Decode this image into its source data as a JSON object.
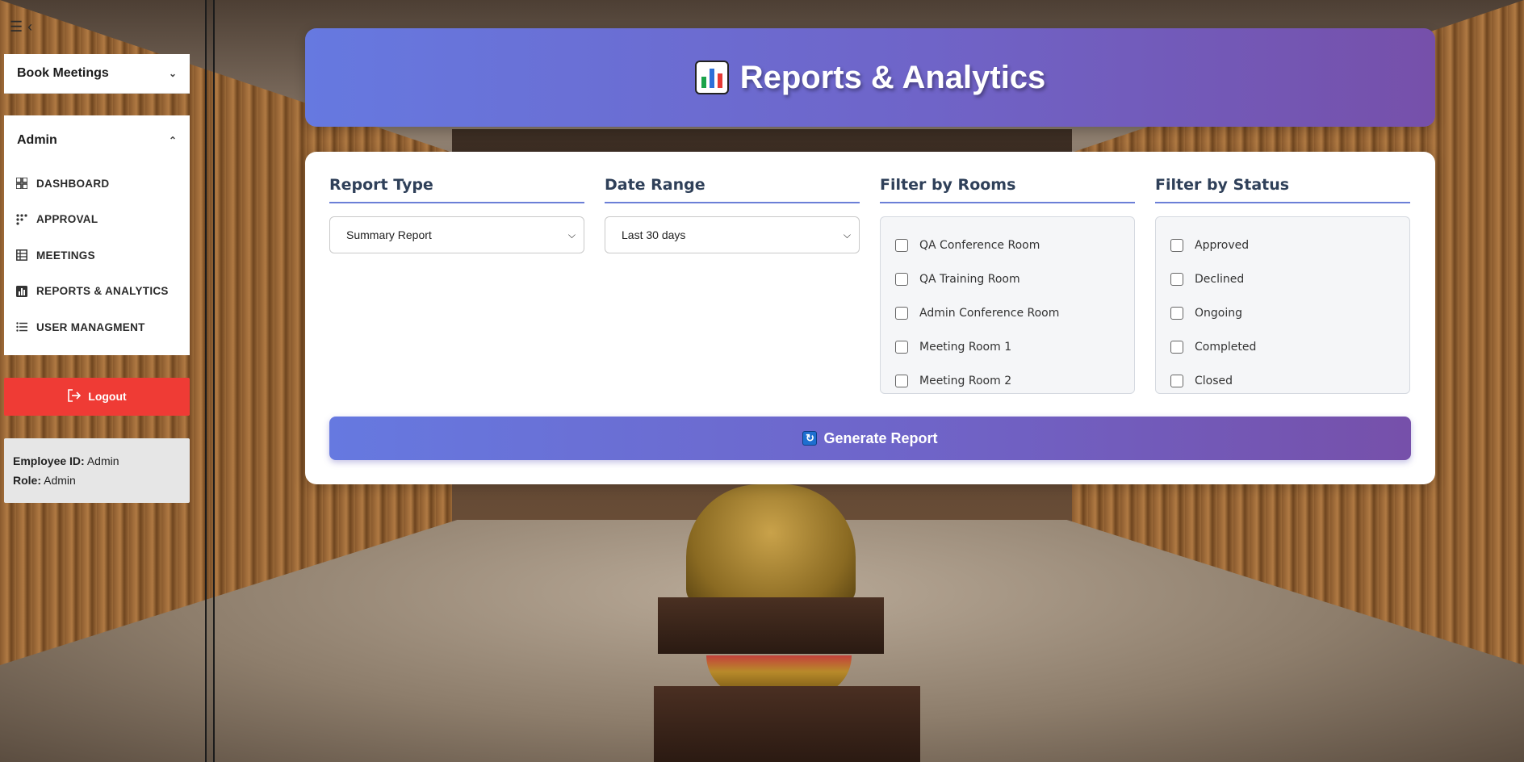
{
  "sidebar": {
    "book_meetings_label": "Book Meetings",
    "admin_label": "Admin",
    "items": [
      {
        "label": "DASHBOARD",
        "icon": "grid-icon"
      },
      {
        "label": "APPROVAL",
        "icon": "dots-icon"
      },
      {
        "label": "MEETINGS",
        "icon": "table-icon"
      },
      {
        "label": "REPORTS & ANALYTICS",
        "icon": "bar-chart-icon"
      },
      {
        "label": "USER MANAGMENT",
        "icon": "list-icon"
      }
    ],
    "logout_label": "Logout",
    "user": {
      "employee_id_label": "Employee ID:",
      "employee_id": "Admin",
      "role_label": "Role:",
      "role": "Admin"
    }
  },
  "header": {
    "title": "Reports & Analytics",
    "icon": "bar-chart-emoji-icon"
  },
  "filters": {
    "report_type": {
      "title": "Report Type",
      "selected": "Summary Report"
    },
    "date_range": {
      "title": "Date Range",
      "selected": "Last 30 days"
    },
    "rooms": {
      "title": "Filter by Rooms",
      "options": [
        "QA Conference Room",
        "QA Training Room",
        "Admin Conference Room",
        "Meeting Room 1",
        "Meeting Room 2"
      ]
    },
    "status": {
      "title": "Filter by Status",
      "options": [
        "Approved",
        "Declined",
        "Ongoing",
        "Completed",
        "Closed"
      ]
    }
  },
  "actions": {
    "generate_label": "Generate Report"
  },
  "colors": {
    "accent_start": "#6679e0",
    "accent_end": "#7650aa",
    "logout": "#ef3b35"
  }
}
